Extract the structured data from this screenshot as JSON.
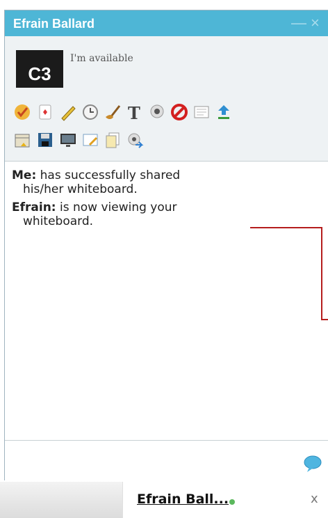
{
  "window": {
    "title": "Efrain Ballard",
    "minimize_glyph": "—",
    "close_glyph": "×"
  },
  "profile": {
    "avatar_text": "C3",
    "status": "I'm available"
  },
  "toolbar": {
    "row1": [
      "emoticon-icon",
      "card-icon",
      "pencil-icon",
      "clock-icon",
      "brush-icon",
      "text-icon",
      "webcam-icon",
      "block-icon",
      "notes-icon",
      "upload-icon"
    ],
    "row2": [
      "calendar-icon",
      "save-icon",
      "monitor-icon",
      "whiteboard-icon",
      "document-copy-icon",
      "webcam-share-icon"
    ]
  },
  "transcript": {
    "messages": [
      {
        "sender": "Me:",
        "text": "has successfully shared",
        "cont": "his/her whiteboard."
      },
      {
        "sender": "Efrain:",
        "text": "is now viewing your",
        "cont": "whiteboard."
      }
    ]
  },
  "taskbar": {
    "tab_name": "Efrain Ball...",
    "close_glyph": "x"
  },
  "colors": {
    "title_bar": "#4eb6d6",
    "annotation": "#b51d1d",
    "presence": "#5bb85d"
  }
}
